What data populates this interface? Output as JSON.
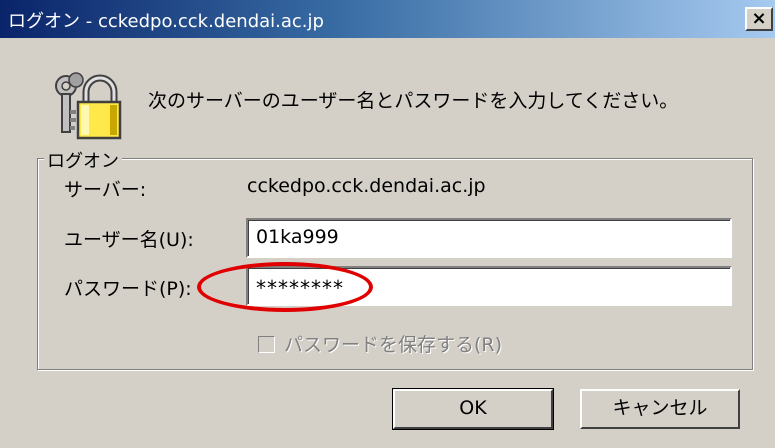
{
  "window": {
    "title": "ログオン - cckedpo.cck.dendai.ac.jp",
    "close_glyph": "×"
  },
  "prompt": {
    "message": "次のサーバーのユーザー名とパスワードを入力してください。",
    "icon": "keys-and-padlock-icon"
  },
  "logon_group": {
    "legend": "ログオン",
    "server_label": "サーバー:",
    "server_value": "cckedpo.cck.dendai.ac.jp",
    "username_label": "ユーザー名(U):",
    "username_value": "01ka999",
    "password_label": "パスワード(P):",
    "password_value": "********",
    "save_password_label": "パスワードを保存する(R)",
    "save_password_checked": false,
    "save_password_enabled": false
  },
  "buttons": {
    "ok_label": "OK",
    "cancel_label": "キャンセル"
  },
  "colors": {
    "dialog_face": "#d4d0c8",
    "title_gradient_start": "#0a246a",
    "title_gradient_end": "#a6caf0",
    "highlight_annotation": "#e00000"
  }
}
